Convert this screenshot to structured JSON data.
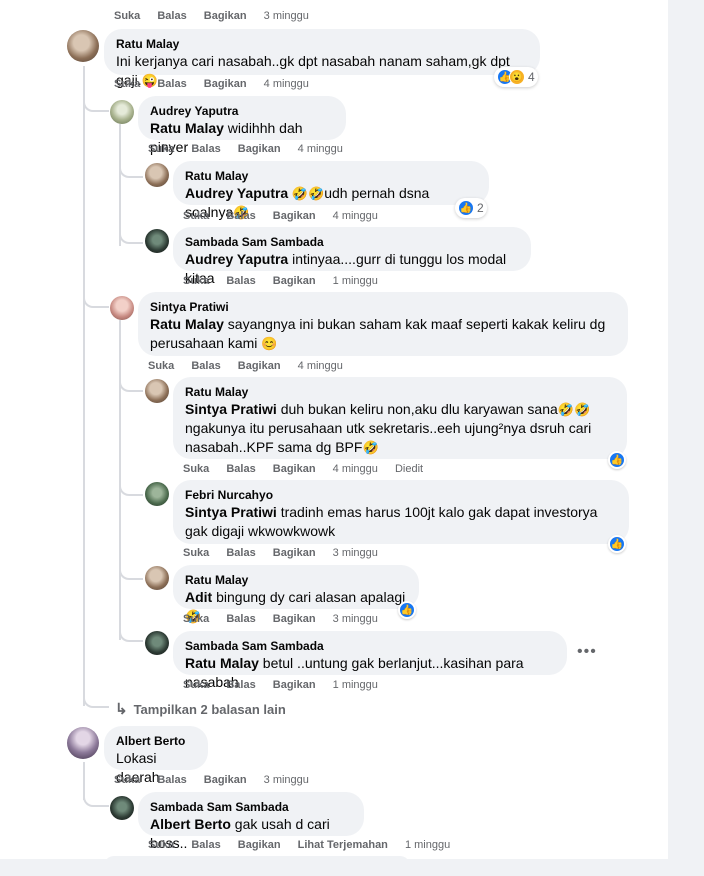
{
  "labels": {
    "like": "Suka",
    "reply": "Balas",
    "share": "Bagikan",
    "translate": "Lihat Terjemahan",
    "edited": "Diedit"
  },
  "comments": [
    {
      "id": "c0",
      "time": "3 minggu"
    },
    {
      "id": "c1",
      "author": "Ratu Malay",
      "text": "Ini kerjanya cari nasabah..gk dpt nasabah nanam saham,gk dpt gaji.",
      "emoji": "😜",
      "time": "4 minggu",
      "reaction_count": "4",
      "replies": [
        {
          "id": "r1",
          "author": "Audrey Yaputra",
          "mention": "Ratu Malay",
          "text": " widihhh dah pinyer",
          "time": "4 minggu"
        },
        {
          "id": "r2",
          "author": "Ratu Malay",
          "mention": "Audrey Yaputra",
          "emoji_pre": " 🤣🤣",
          "text": "udh pernah dsna soalnya",
          "emoji": "🤣",
          "time": "4 minggu",
          "reaction_count": "2"
        },
        {
          "id": "r3",
          "author": "Sambada Sam Sambada",
          "mention": "Audrey Yaputra",
          "text": " intinyaa....gurr di tunggu los modal kitaa",
          "time": "1 minggu"
        },
        {
          "id": "r4",
          "author": "Sintya Pratiwi",
          "mention": "Ratu Malay",
          "text": " sayangnya ini bukan saham kak maaf seperti kakak keliru dg perusahaan kami ",
          "emoji": "😊",
          "time": "4 minggu"
        },
        {
          "id": "r5",
          "author": "Ratu Malay",
          "mention": "Sintya Pratiwi",
          "text": " duh bukan keliru non,aku dlu karyawan sana",
          "emoji": "🤣🤣",
          "text2": " ngakunya itu perusahaan utk sekretaris..eeh ujung²nya dsruh cari nasabah..KPF sama dg BPF",
          "emoji2": "🤣",
          "time": "4 minggu"
        },
        {
          "id": "r6",
          "author": "Febri Nurcahyo",
          "mention": "Sintya Pratiwi",
          "text": " tradinh emas harus 100jt kalo gak dapat investorya gak digaji wkwowkwowk",
          "time": "3 minggu"
        },
        {
          "id": "r7",
          "author": "Ratu Malay",
          "mention": "Adit",
          "text": " bingung dy cari alasan apalagi",
          "emoji": "🤣",
          "time": "3 minggu"
        },
        {
          "id": "r8",
          "author": "Sambada Sam Sambada",
          "mention": "Ratu Malay",
          "text": " betul ..untung gak berlanjut...kasihan para nasabah",
          "time": "1 minggu"
        }
      ],
      "more_replies": "Tampilkan 2 balasan lain"
    },
    {
      "id": "c2",
      "author": "Albert Berto",
      "text": "Lokasi daerah",
      "time": "3 minggu",
      "replies": [
        {
          "id": "r9",
          "author": "Sambada Sam Sambada",
          "mention": "Albert Berto",
          "text": " gak usah d cari boss..",
          "time": "1 minggu"
        }
      ]
    }
  ]
}
